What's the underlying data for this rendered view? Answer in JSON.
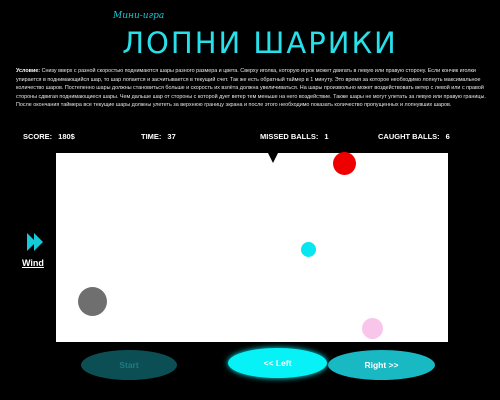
{
  "header": {
    "subtitle": "Мини-игра",
    "title": "ЛОПНИ  ШАРИКИ"
  },
  "rules": {
    "label": "Условие:",
    "text": "Снизу вверх с разной скоростью поднимаются шары разного размера и цвета. Сверху иголка, которую игрок может двигать в левую или правую сторону. Если кончик иголки упирается в поднимающийся шар, то шар лопается и засчитывается в текущий счет. Так же есть обратный таймер в 1 минуту. Это время за которое необходимо лопнуть максимальное количество шаров. Постепенно шары должны становиться больше и скорость их взлёта должна увеличиваться. На шары произвольно может воздействовать ветер с левой или с правой стороны сдвигая поднимающиеся шары. Чем дальше шар от стороны с которой дует ветер тем меньше на него воздействие. Также шары не могут улетать за левую или правую границы. После окончания таймера все текущие шары должны улететь за верхнюю границу экрана и после этого необходимо показать количество пропущенных и лопнувших шаров."
  },
  "stats": {
    "score_label": "SCORE:",
    "score_value": "180$",
    "time_label": "TIME:",
    "time_value": "37",
    "missed_label": "MISSED BALLS:",
    "missed_value": "1",
    "caught_label": "CAUGHT BALLS:",
    "caught_value": "6"
  },
  "balls": [
    {
      "name": "red-ball",
      "color": "#ee0000"
    },
    {
      "name": "cyan-ball",
      "color": "#09e6ef"
    },
    {
      "name": "gray-ball",
      "color": "#6f6f6f"
    },
    {
      "name": "pink-ball",
      "color": "#f7c6ea"
    }
  ],
  "wind": {
    "label": "Wind",
    "direction": "right",
    "color": "#17c9d8"
  },
  "buttons": {
    "start": "Start",
    "left": "<< Left",
    "right": "Right >>"
  }
}
